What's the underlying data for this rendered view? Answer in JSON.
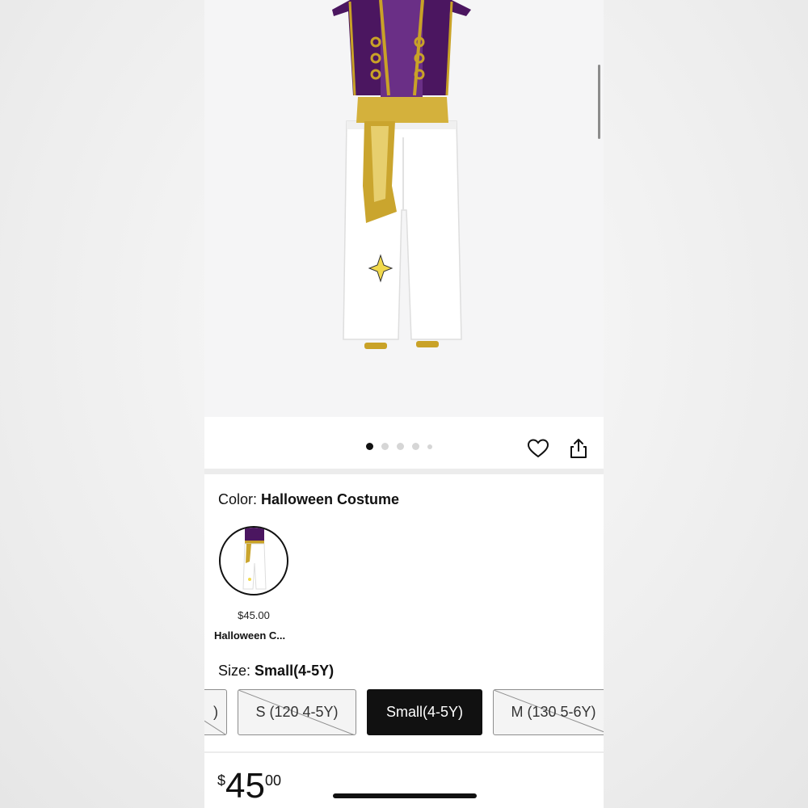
{
  "product": {
    "image_alt": "Purple vest and white pants costume",
    "gallery": {
      "count": 5,
      "active_index": 0
    }
  },
  "icons": {
    "favorite": "heart-icon",
    "share": "share-icon"
  },
  "color": {
    "label": "Color:",
    "value": "Halloween Costume",
    "swatch": {
      "price": "$45.00",
      "name": "Halloween C..."
    }
  },
  "size": {
    "label": "Size:",
    "value": "Small(4-5Y)",
    "options": [
      {
        "label": ")",
        "available": false,
        "selected": false
      },
      {
        "label": "S (120 4-5Y)",
        "available": false,
        "selected": false
      },
      {
        "label": "Small(4-5Y)",
        "available": true,
        "selected": true
      },
      {
        "label": "M (130 5-6Y)",
        "available": false,
        "selected": false
      }
    ]
  },
  "price": {
    "currency": "$",
    "whole": "45",
    "fraction": "00"
  },
  "colors": {
    "selected_bg": "#111111",
    "vest_purple": "#4b1660",
    "gold": "#c9a227"
  }
}
